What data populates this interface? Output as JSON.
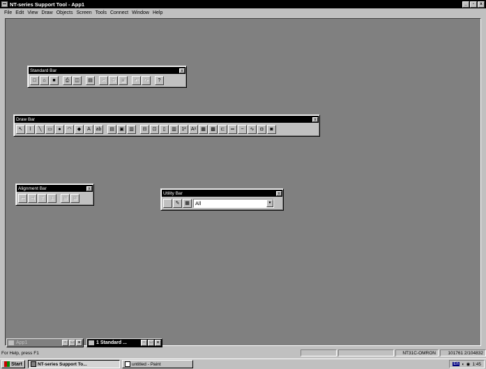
{
  "window": {
    "title": "NT-series Support Tool - App1"
  },
  "menu": [
    "File",
    "Edit",
    "View",
    "Draw",
    "Objects",
    "Screen",
    "Tools",
    "Connect",
    "Window",
    "Help"
  ],
  "standard_bar": {
    "title": "Standard Bar",
    "close": "x",
    "buttons": [
      {
        "name": "new",
        "glyph": "□",
        "enabled": true
      },
      {
        "name": "open",
        "glyph": "⌂",
        "enabled": true
      },
      {
        "name": "save",
        "glyph": "■",
        "enabled": true
      },
      {
        "name": "print",
        "glyph": "⎙",
        "enabled": true
      },
      {
        "name": "print-preview",
        "glyph": "◫",
        "enabled": true
      },
      {
        "name": "transfer",
        "glyph": "▤",
        "enabled": true
      },
      {
        "name": "cut",
        "glyph": "✂",
        "enabled": false
      },
      {
        "name": "copy",
        "glyph": "⧉",
        "enabled": false
      },
      {
        "name": "paste",
        "glyph": "▣",
        "enabled": false
      },
      {
        "name": "undo",
        "glyph": "↶",
        "enabled": false
      },
      {
        "name": "redo",
        "glyph": "↷",
        "enabled": false
      },
      {
        "name": "context-help",
        "glyph": "?",
        "enabled": true
      }
    ]
  },
  "draw_bar": {
    "title": "Draw Bar",
    "close": "x",
    "buttons": [
      "↖",
      "⌇",
      "╲",
      "▭",
      "●",
      "◠",
      "◆",
      "A",
      "ab",
      "▤",
      "▣",
      "▥",
      "⊟",
      "⊡",
      "▯",
      "▥",
      "1²",
      "Aᵃ",
      "▦",
      "▩",
      "⊏",
      "═",
      "~",
      "∿",
      "◘",
      "◙"
    ]
  },
  "alignment_bar": {
    "title": "Alignment Bar",
    "close": "x",
    "buttons": [
      "⊢",
      "⊣",
      "⊤",
      "⊥",
      "⊞",
      "⊠"
    ]
  },
  "utility_bar": {
    "title": "Utility Bar",
    "close": "x",
    "buttons": [
      "",
      "✎",
      "▦"
    ],
    "select_value": "All"
  },
  "minimized": [
    {
      "label": "App1",
      "active": false
    },
    {
      "label": "1 Standard ...",
      "active": true
    }
  ],
  "statusbar": {
    "help": "For Help, press F1",
    "p2": "",
    "p3": "",
    "model": "NT31C-OMRON",
    "size": "101761 2/104832"
  },
  "taskbar": {
    "start": "Start",
    "tasks": [
      {
        "label": "NT-series Support To...",
        "active": true
      },
      {
        "label": "untitled - Paint",
        "active": false
      }
    ],
    "clock": "1:45"
  }
}
